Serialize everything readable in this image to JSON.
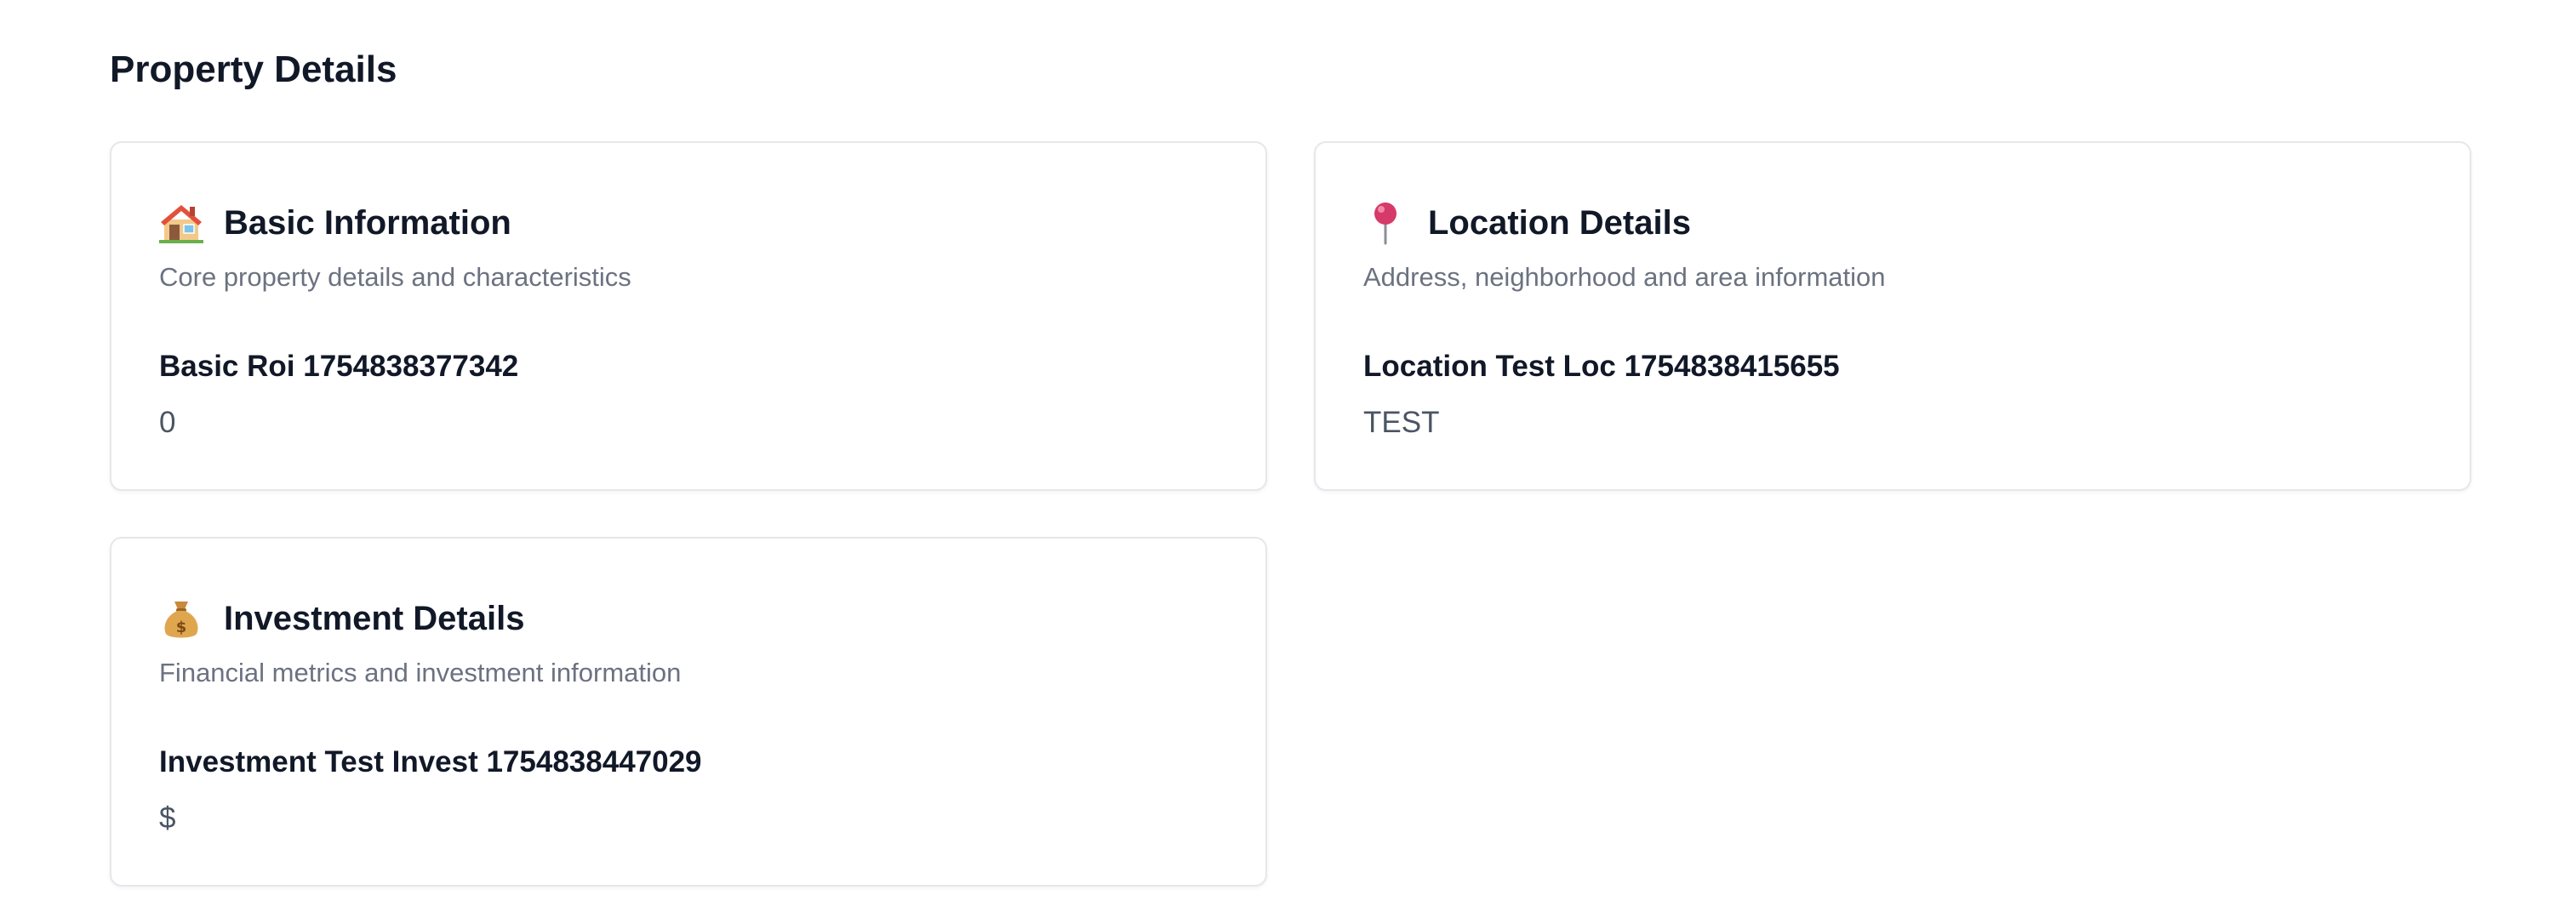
{
  "page_title": "Property Details",
  "sections": {
    "basic": {
      "icon": "house-icon",
      "title": "Basic Information",
      "subtitle": "Core property details and characteristics",
      "field_label": "Basic Roi 1754838377342",
      "field_value": "0"
    },
    "location": {
      "icon": "pin-icon",
      "title": "Location Details",
      "subtitle": "Address, neighborhood and area information",
      "field_label": "Location Test Loc 1754838415655",
      "field_value": "TEST"
    },
    "investment": {
      "icon": "money-bag-icon",
      "title": "Investment Details",
      "subtitle": "Financial metrics and investment information",
      "field_label": "Investment Test Invest 1754838447029",
      "field_value": "$"
    }
  },
  "colors": {
    "title_text": "#111827",
    "muted_text": "#6b7280",
    "value_text": "#4b5563",
    "card_border": "#e5e7eb"
  }
}
